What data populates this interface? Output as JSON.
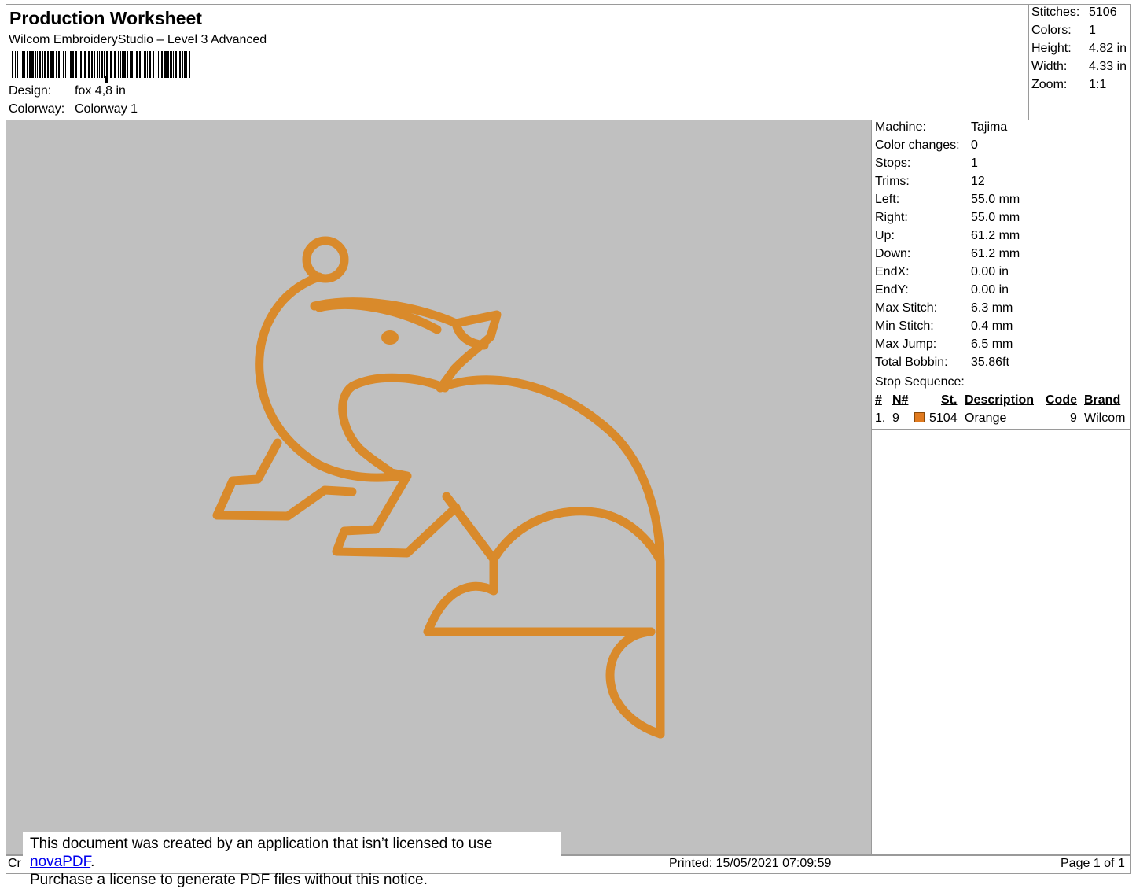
{
  "header": {
    "title": "Production Worksheet",
    "subtitle": "Wilcom EmbroideryStudio – Level 3 Advanced",
    "design_label": "Design:",
    "design_value": "fox 4,8 in",
    "colorway_label": "Colorway:",
    "colorway_value": "Colorway 1",
    "barcode_icon": "barcode-icon"
  },
  "summary": [
    {
      "label": "Stitches:",
      "value": "5106"
    },
    {
      "label": "Colors:",
      "value": "1"
    },
    {
      "label": "Height:",
      "value": "4.82 in"
    },
    {
      "label": "Width:",
      "value": "4.33 in"
    },
    {
      "label": "Zoom:",
      "value": "1:1"
    }
  ],
  "machine_info": [
    {
      "label": "Machine:",
      "value": "Tajima"
    },
    {
      "label": "Color changes:",
      "value": "0"
    },
    {
      "label": "Stops:",
      "value": "1"
    },
    {
      "label": "Trims:",
      "value": "12"
    },
    {
      "label": "Left:",
      "value": "55.0 mm"
    },
    {
      "label": "Right:",
      "value": "55.0 mm"
    },
    {
      "label": "Up:",
      "value": "61.2 mm"
    },
    {
      "label": "Down:",
      "value": "61.2 mm"
    },
    {
      "label": "EndX:",
      "value": "0.00 in"
    },
    {
      "label": "EndY:",
      "value": "0.00 in"
    },
    {
      "label": "Max Stitch:",
      "value": "6.3 mm"
    },
    {
      "label": "Min Stitch:",
      "value": "0.4 mm"
    },
    {
      "label": "Max Jump:",
      "value": "6.5 mm"
    },
    {
      "label": "Total Bobbin:",
      "value": "35.86ft"
    }
  ],
  "stop_sequence": {
    "title": "Stop Sequence:",
    "columns": [
      "#",
      "N#",
      "St.",
      "Description",
      "Code",
      "Brand"
    ],
    "rows": [
      {
        "index": "1.",
        "n": "9",
        "color": "#e07a1f",
        "st": "5104",
        "description": "Orange",
        "code": "9",
        "brand": "Wilcom"
      }
    ]
  },
  "design": {
    "thread_color": "#d98a2b",
    "background_color": "#c0c0c0",
    "icon": "fox-embroidery-outline"
  },
  "footer": {
    "left_fragment": "Cr",
    "printed": "Printed: 15/05/2021 07:09:59",
    "page": "Page 1 of 1"
  },
  "notice": {
    "line1_prefix": "This document was created by an application that isn’t licensed to use ",
    "link_text": "novaPDF",
    "line1_suffix": ".",
    "line2": "Purchase a license to generate PDF files without this notice."
  }
}
